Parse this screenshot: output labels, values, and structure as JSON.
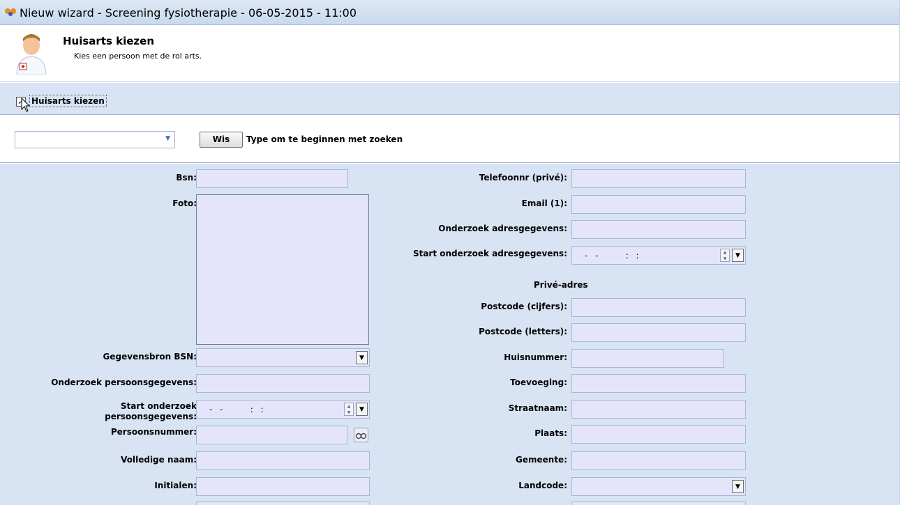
{
  "window": {
    "title": "Nieuw wizard - Screening fysiotherapie - 06-05-2015 - 11:00",
    "icon": "app-logo-icon"
  },
  "header": {
    "title": "Huisarts kiezen",
    "subtitle": "Kies een persoon met de rol arts.",
    "icon": "doctor-avatar-icon"
  },
  "checkbox": {
    "label": "Huisarts kiezen",
    "checked": true,
    "mark": "✓"
  },
  "search": {
    "value": "",
    "clear_label": "Wis",
    "hint": "Type om te beginnen met zoeken"
  },
  "left": {
    "bsn": "Bsn:",
    "foto": "Foto:",
    "gegevensbron": "Gegevensbron BSN:",
    "onderzoek_persoon": "Onderzoek persoonsgegevens:",
    "start_onderzoek_line1": "Start onderzoek",
    "start_onderzoek_line2": "persoonsgegevens:",
    "persoonsnummer": "Persoonsnummer:",
    "volledige_naam": "Volledige naam:",
    "initialen": "Initialen:",
    "date_mask": "-  -        :  :"
  },
  "right": {
    "telefoon": "Telefoonnr (privé):",
    "email": "Email (1):",
    "onderzoek_adres": "Onderzoek adresgegevens:",
    "start_onderzoek_adres": "Start onderzoek adresgegevens:",
    "prive_adres": "Privé-adres",
    "postcode_cijfers": "Postcode (cijfers):",
    "postcode_letters": "Postcode (letters):",
    "huisnummer": "Huisnummer:",
    "toevoeging": "Toevoeging:",
    "straatnaam": "Straatnaam:",
    "plaats": "Plaats:",
    "gemeente": "Gemeente:",
    "landcode": "Landcode:",
    "date_mask": "-  -        :  :"
  }
}
